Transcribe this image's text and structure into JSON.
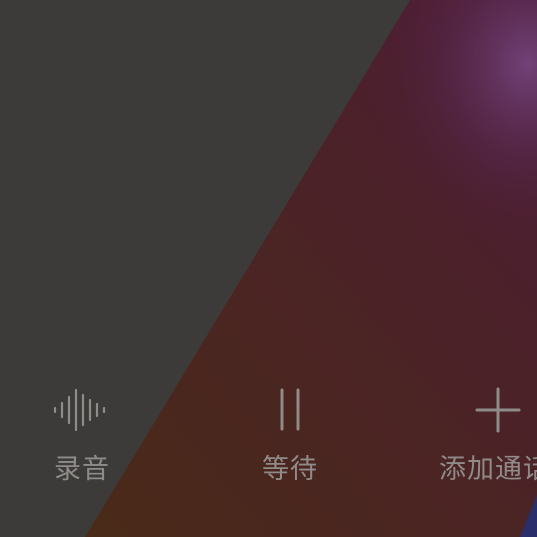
{
  "call_actions": {
    "record": {
      "label": "录音",
      "icon": "waveform-icon"
    },
    "hold": {
      "label": "等待",
      "icon": "pause-icon"
    },
    "add_call": {
      "label": "添加通话",
      "icon": "plus-icon"
    }
  },
  "colors": {
    "background": "#3d3b39",
    "wallpaper_warm": "#4a2b22",
    "wallpaper_accent": "#5a2140",
    "icon_and_label": "#8f8b88"
  }
}
